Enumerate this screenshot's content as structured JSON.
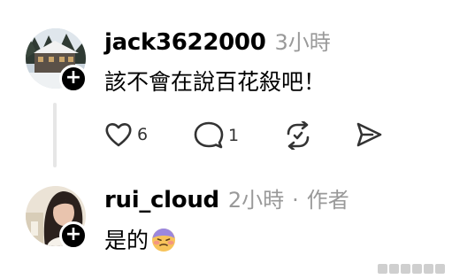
{
  "comments": [
    {
      "username": "jack3622000",
      "time": "3小時",
      "text": "該不會在說百花殺吧！",
      "actions": {
        "like_count": "6",
        "reply_count": "1"
      }
    },
    {
      "username": "rui_cloud",
      "time": "2小時",
      "separator": "·",
      "role": "作者",
      "text": "是的"
    }
  ],
  "icons": {
    "like": "heart-icon",
    "reply": "comment-bubble-icon",
    "repost": "repost-icon",
    "share": "send-icon",
    "follow": "plus-icon",
    "reaction": "grimacing-face-emoji"
  },
  "colors": {
    "muted_text": "#999999",
    "badge_bg": "#000000",
    "thread_line": "#e6e6e6"
  }
}
